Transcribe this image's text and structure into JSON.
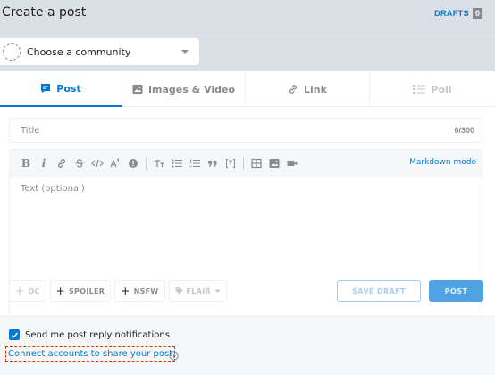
{
  "header": {
    "title": "Create a post",
    "drafts_label": "DRAFTS",
    "drafts_count": "0"
  },
  "community": {
    "label": "Choose a community",
    "icon": "chevron-down-icon"
  },
  "tabs": [
    {
      "label": "Post",
      "icon": "post-icon",
      "state": "active"
    },
    {
      "label": "Images & Video",
      "icon": "image-icon",
      "state": "normal"
    },
    {
      "label": "Link",
      "icon": "link-icon",
      "state": "normal"
    },
    {
      "label": "Poll",
      "icon": "poll-icon",
      "state": "disabled"
    }
  ],
  "title_field": {
    "placeholder": "Title",
    "value": "",
    "counter": "0/300"
  },
  "editor": {
    "placeholder": "Text (optional)",
    "value": "",
    "markdown_mode_label": "Markdown mode",
    "toolbar": {
      "bold": "B",
      "italic": "i",
      "link": "link-icon",
      "strikethrough": "strikethrough-icon",
      "inline_code": "inline-code-icon",
      "superscript": "superscript-icon",
      "spoiler": "spoiler-icon",
      "heading": "heading-icon",
      "bulleted_list": "bulleted-list-icon",
      "numbered_list": "numbered-list-icon",
      "quote": "quote-icon",
      "code_block": "code-block-icon",
      "table": "table-icon",
      "image": "image-icon",
      "video": "video-icon"
    }
  },
  "chips": {
    "oc": "OC",
    "spoiler": "SPOILER",
    "nsfw": "NSFW",
    "flair": "FLAIR"
  },
  "actions": {
    "save_draft": "SAVE DRAFT",
    "post": "POST"
  },
  "footer": {
    "notify_label": "Send me post reply notifications",
    "notify_checked": true,
    "connect_label": "Connect accounts to share your post"
  },
  "colors": {
    "accent": "#0079d3",
    "background": "#dae0e6",
    "muted": "#878a8c"
  }
}
